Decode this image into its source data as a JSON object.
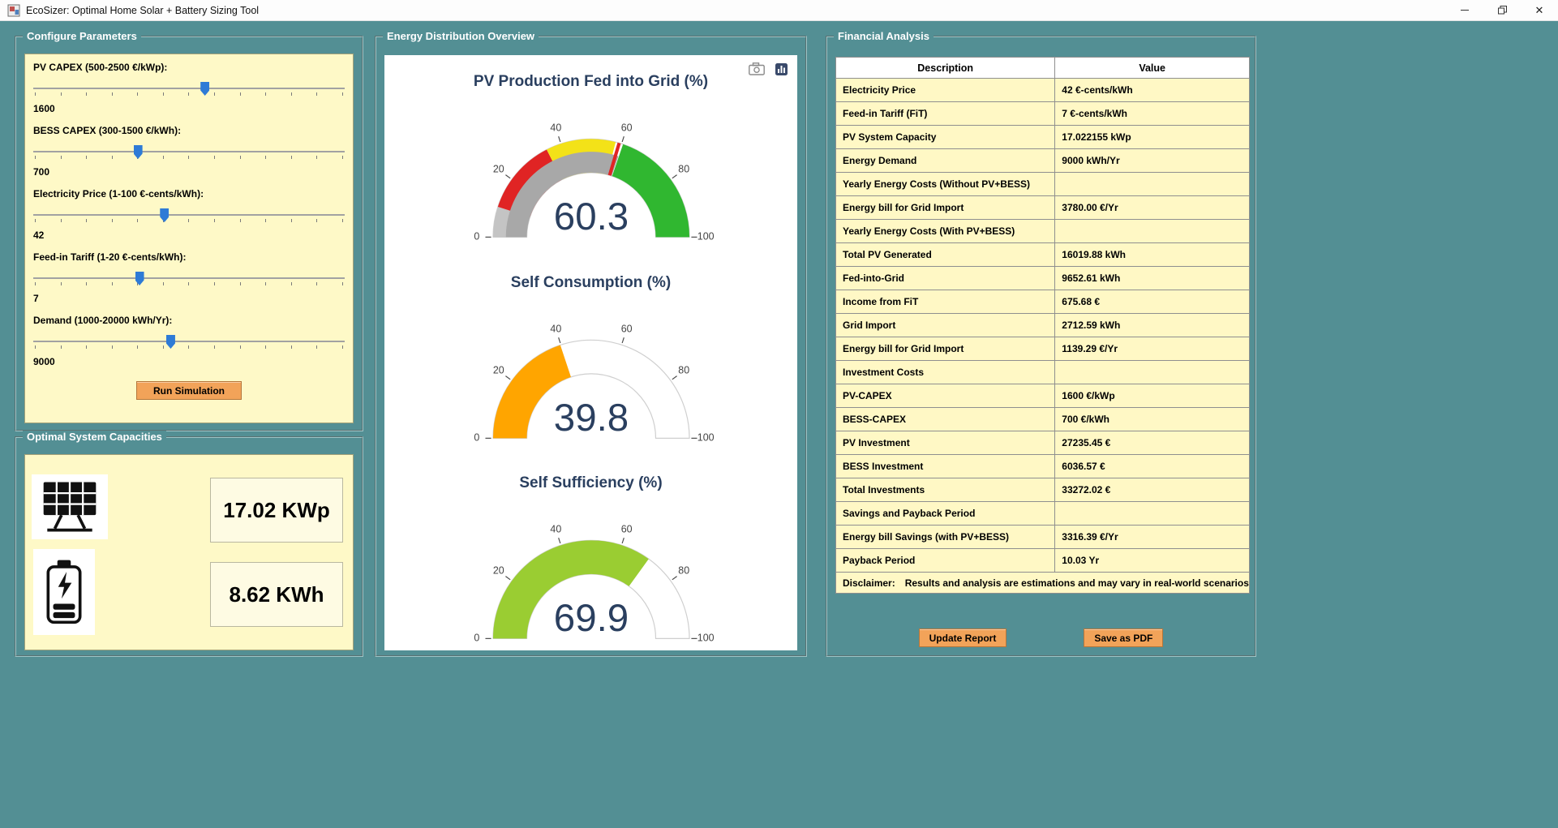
{
  "window": {
    "title": "EcoSizer: Optimal Home Solar + Battery Sizing Tool",
    "close_glyph": "✕"
  },
  "colors": {
    "background": "#538f94",
    "panel": "#FEF9C7",
    "table_row": "#FFF8C5",
    "button": "#F2A359",
    "slider_thumb": "#2E7BD6",
    "gauge_number": "#2a3f5f"
  },
  "panels": {
    "configure": {
      "title": "Configure Parameters",
      "run_label": "Run Simulation",
      "sliders": [
        {
          "name": "pv-capex",
          "label": "PV CAPEX (500-2500 €/kWp):",
          "value": "1600",
          "percent": 55
        },
        {
          "name": "bess-capex",
          "label": "BESS CAPEX (300-1500 €/kWh):",
          "value": "700",
          "percent": 33.5
        },
        {
          "name": "electricity-price",
          "label": "Electricity Price (1-100 €-cents/kWh):",
          "value": "42",
          "percent": 42
        },
        {
          "name": "feed-in-tariff",
          "label": "Feed-in Tariff (1-20 €-cents/kWh):",
          "value": "7",
          "percent": 34
        },
        {
          "name": "demand",
          "label": "Demand (1000-20000 kWh/Yr):",
          "value": "9000",
          "percent": 44
        }
      ]
    },
    "capacities": {
      "title": "Optimal System Capacities",
      "pv_value": "17.02 KWp",
      "bess_value": "8.62 KWh"
    },
    "energy": {
      "title": "Energy Distribution Overview"
    },
    "financial": {
      "title": "Financial Analysis",
      "headers": [
        "Description",
        "Value"
      ],
      "rows": [
        [
          "Electricity Price",
          "42 €-cents/kWh"
        ],
        [
          "Feed-in Tariff (FiT)",
          "7 €-cents/kWh"
        ],
        [
          "PV System Capacity",
          "17.022155 kWp"
        ],
        [
          "Energy Demand",
          "9000 kWh/Yr"
        ],
        [
          "Yearly Energy Costs (Without PV+BESS)",
          ""
        ],
        [
          "Energy bill for Grid Import",
          "3780.00 €/Yr"
        ],
        [
          "Yearly Energy Costs (With PV+BESS)",
          ""
        ],
        [
          "Total PV Generated",
          "16019.88 kWh"
        ],
        [
          "Fed-into-Grid",
          "9652.61 kWh"
        ],
        [
          "Income from FiT",
          "675.68 €"
        ],
        [
          "Grid Import",
          "2712.59 kWh"
        ],
        [
          "Energy bill for Grid Import",
          "1139.29 €/Yr"
        ],
        [
          "Investment Costs",
          ""
        ],
        [
          "PV-CAPEX",
          "1600 €/kWp"
        ],
        [
          "BESS-CAPEX",
          "700 €/kWh"
        ],
        [
          "PV Investment",
          "27235.45 €"
        ],
        [
          "BESS Investment",
          "6036.57 €"
        ],
        [
          "Total Investments",
          "33272.02 €"
        ],
        [
          "Savings and Payback Period",
          ""
        ],
        [
          "Energy bill Savings (with PV+BESS)",
          "3316.39 €/Yr"
        ],
        [
          "Payback Period",
          "10.03 Yr"
        ]
      ],
      "disclaimer_label": "Disclaimer:",
      "disclaimer_text": "Results and analysis are estimations and may vary in real-world scenarios",
      "update_button": "Update Report",
      "save_button": "Save as PDF"
    }
  },
  "chart_data": [
    {
      "type": "gauge",
      "title": "PV Production Fed into Grid (%)",
      "value": 60.3,
      "range": [
        0,
        100
      ],
      "ticks": [
        0,
        20,
        40,
        60,
        80,
        100
      ],
      "bar": {
        "color": "#a8a8a8",
        "thickness": 0.62
      },
      "steps": [
        {
          "range": [
            0,
            10
          ],
          "color": "#c4c4c4"
        },
        {
          "range": [
            10,
            35
          ],
          "color": "#e02424"
        },
        {
          "range": [
            35,
            58
          ],
          "color": "#f3e218"
        },
        {
          "range": [
            60.5,
            100
          ],
          "color": "#30b730"
        }
      ],
      "threshold": {
        "value": 59.2,
        "color": "#e02424"
      },
      "number_color": "#2a3f5f"
    },
    {
      "type": "gauge",
      "title": "Self Consumption (%)",
      "value": 39.8,
      "range": [
        0,
        100
      ],
      "ticks": [
        0,
        20,
        40,
        60,
        80,
        100
      ],
      "bar": {
        "color": "#ffa500",
        "thickness": 1
      },
      "steps": [],
      "number_color": "#2a3f5f"
    },
    {
      "type": "gauge",
      "title": "Self Sufficiency (%)",
      "value": 69.9,
      "range": [
        0,
        100
      ],
      "ticks": [
        0,
        20,
        40,
        60,
        80,
        100
      ],
      "bar": {
        "color": "#9acd32",
        "thickness": 1
      },
      "steps": [],
      "number_color": "#2a3f5f"
    }
  ]
}
